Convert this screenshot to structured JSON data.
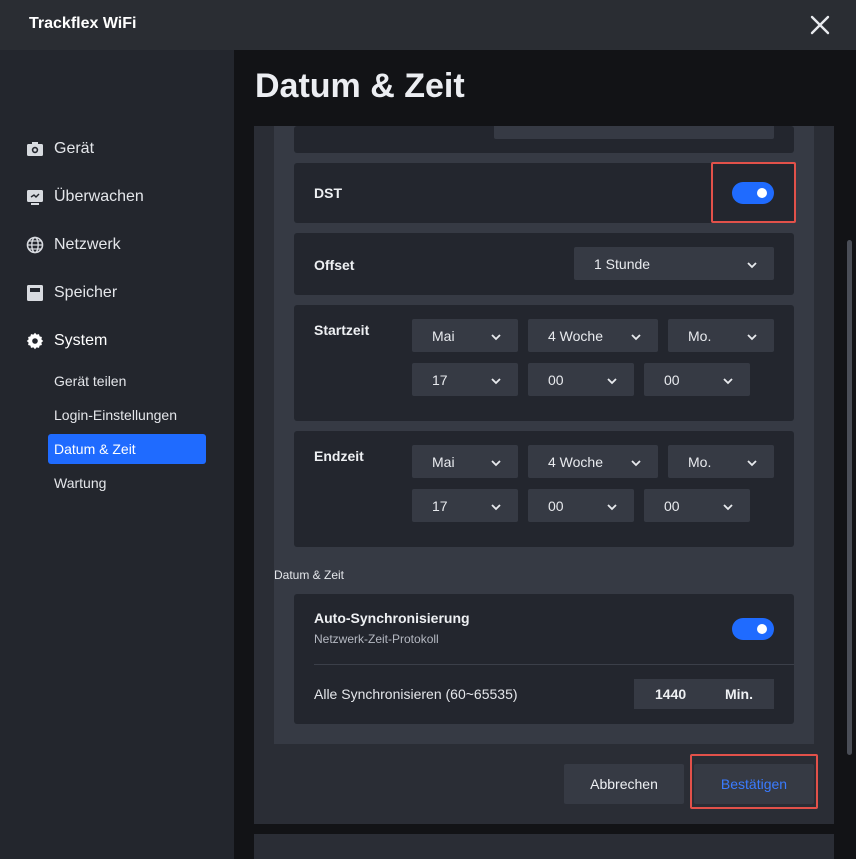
{
  "window": {
    "title": "Trackflex WiFi"
  },
  "sidebar": {
    "items": [
      {
        "label": "Gerät",
        "icon": "camera-icon"
      },
      {
        "label": "Überwachen",
        "icon": "monitor-icon"
      },
      {
        "label": "Netzwerk",
        "icon": "globe-icon"
      },
      {
        "label": "Speicher",
        "icon": "storage-icon"
      },
      {
        "label": "System",
        "icon": "gear-icon"
      }
    ],
    "subitems": [
      {
        "label": "Gerät teilen"
      },
      {
        "label": "Login-Einstellungen"
      },
      {
        "label": "Datum & Zeit"
      },
      {
        "label": "Wartung"
      }
    ],
    "active_subitem": "Datum & Zeit"
  },
  "page": {
    "title": "Datum & Zeit"
  },
  "dst": {
    "label": "DST",
    "enabled": true
  },
  "offset": {
    "label": "Offset",
    "value": "1 Stunde"
  },
  "startzeit": {
    "label": "Startzeit",
    "month": "Mai",
    "week": "4 Woche",
    "day": "Mo.",
    "hour": "17",
    "minute": "00",
    "second": "00"
  },
  "endzeit": {
    "label": "Endzeit",
    "month": "Mai",
    "week": "4 Woche",
    "day": "Mo.",
    "hour": "17",
    "minute": "00",
    "second": "00"
  },
  "datetime_section": {
    "caption": "Datum & Zeit",
    "auto_sync": {
      "label": "Auto-Synchronisierung",
      "sublabel": "Netzwerk-Zeit-Protokoll",
      "enabled": true
    },
    "interval": {
      "label": "Alle Synchronisieren (60~65535)",
      "value": "1440",
      "unit": "Min."
    }
  },
  "buttons": {
    "cancel": "Abbrechen",
    "confirm": "Bestätigen"
  },
  "colors": {
    "accent": "#1f6bff",
    "highlight": "#e2514a",
    "confirm_text": "#3a7bff"
  }
}
